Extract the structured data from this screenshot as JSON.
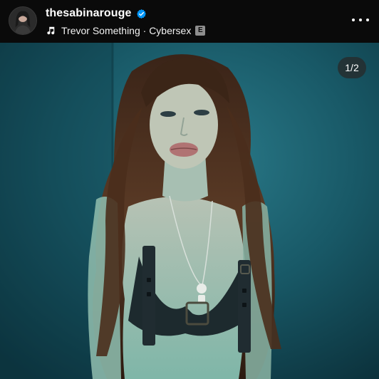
{
  "post": {
    "username": "thesabinarouge",
    "verified": true,
    "music": {
      "track": "Trevor Something · Cybersex",
      "explicit_badge": "E"
    },
    "counter": "1/2",
    "icons": {
      "verified": "verified-badge-icon",
      "music": "music-note-icon",
      "more": "more-options-icon"
    },
    "colors": {
      "header_bg": "#0a0a0a",
      "verified_blue": "#0095f6",
      "backdrop_teal": "#174f5c"
    }
  }
}
